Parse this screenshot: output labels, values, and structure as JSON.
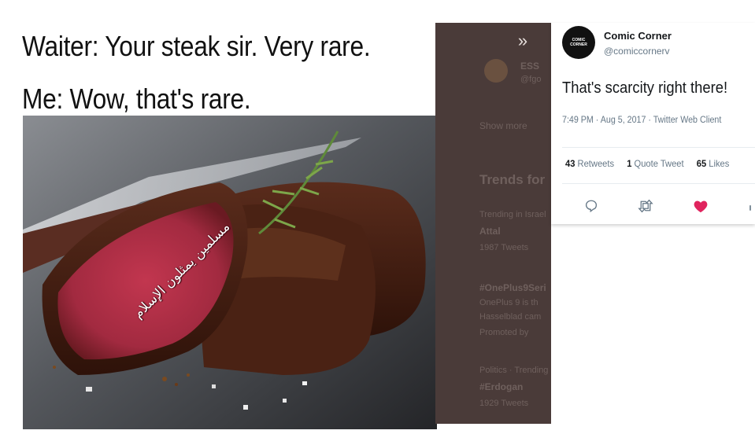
{
  "meme": {
    "line1": "Waiter: Your steak sir. Very rare.",
    "line2": "Me: Wow, that's rare.",
    "arabic_caption": "مسلمين يمثلون الإسلام"
  },
  "dim_panel": {
    "collapse_glyph": "»",
    "ghost_name": "ESS",
    "ghost_handle": "@fgo",
    "show_more": "Show more",
    "trends_title": "Trends for",
    "trend1_context": "Trending in Israel",
    "trend1_name": "Attal",
    "trend1_count": "1987 Tweets",
    "trend2_name": "#OnePlus9Seri",
    "trend2_desc_a": "OnePlus 9 is th",
    "trend2_desc_b": "Hasselblad cam",
    "trend2_promoted": "Promoted by",
    "trend3_context": "Politics · Trending",
    "trend3_name": "#Erdogan",
    "trend3_count": "1929 Tweets"
  },
  "tweet": {
    "avatar_text_top": "COMIC",
    "avatar_text_bottom": "CORNER",
    "display_name": "Comic Corner",
    "handle": "@comiccornerv",
    "text": "That's scarcity right there!",
    "meta": "7:49 PM · Aug 5, 2017 · Twitter Web Client",
    "retweets_count": "43",
    "retweets_label": "Retweets",
    "quotes_count": "1",
    "quotes_label": "Quote Tweet",
    "likes_count": "65",
    "likes_label": "Likes",
    "like_color": "#e0245e"
  },
  "icons": {
    "reply": "reply-icon",
    "retweet": "retweet-icon",
    "like": "heart-icon",
    "share": "share-icon"
  }
}
